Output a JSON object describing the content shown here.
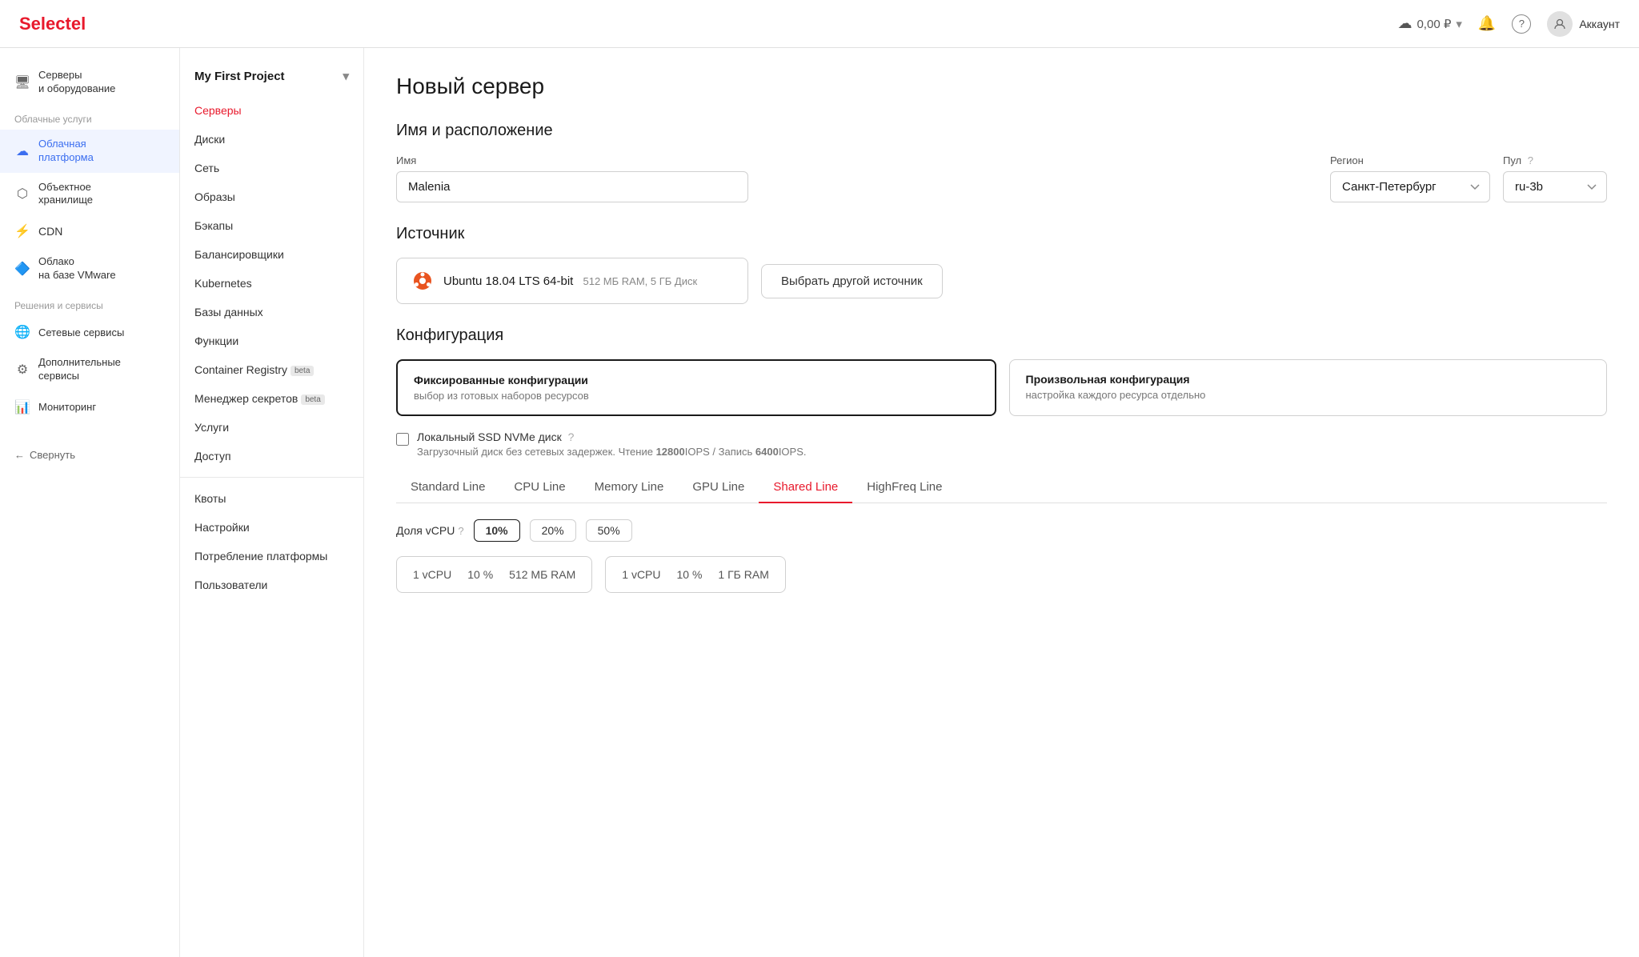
{
  "header": {
    "logo_prefix": "Select",
    "logo_highlight": "el",
    "balance": "0,00 ₽",
    "account_label": "Аккаунт"
  },
  "sidebar_left": {
    "section1": "Облачные услуги",
    "section2": "Решения и сервисы",
    "items": [
      {
        "id": "servers",
        "icon": "🖥",
        "label": "Серверы и оборудование",
        "active": false
      },
      {
        "id": "cloud",
        "icon": "☁",
        "label": "Облачная платформа",
        "active": true
      },
      {
        "id": "object",
        "icon": "📦",
        "label": "Объектное хранилище",
        "active": false
      },
      {
        "id": "cdn",
        "icon": "⚡",
        "label": "CDN",
        "active": false
      },
      {
        "id": "vmware",
        "icon": "🔷",
        "label": "Облако на базе VMware",
        "active": false
      },
      {
        "id": "network",
        "icon": "🌐",
        "label": "Сетевые сервисы",
        "active": false
      },
      {
        "id": "extra",
        "icon": "⚙",
        "label": "Дополнительные сервисы",
        "active": false
      },
      {
        "id": "monitor",
        "icon": "📊",
        "label": "Мониторинг",
        "active": false
      }
    ],
    "collapse_label": "Свернуть"
  },
  "sidebar_mid": {
    "project_name": "My First Project",
    "nav_items": [
      {
        "id": "servers",
        "label": "Серверы",
        "active": true
      },
      {
        "id": "disks",
        "label": "Диски",
        "active": false
      },
      {
        "id": "network",
        "label": "Сеть",
        "active": false
      },
      {
        "id": "images",
        "label": "Образы",
        "active": false
      },
      {
        "id": "backups",
        "label": "Бэкапы",
        "active": false
      },
      {
        "id": "balancers",
        "label": "Балансировщики",
        "active": false
      },
      {
        "id": "kubernetes",
        "label": "Kubernetes",
        "active": false
      },
      {
        "id": "databases",
        "label": "Базы данных",
        "active": false
      },
      {
        "id": "functions",
        "label": "Функции",
        "active": false
      },
      {
        "id": "registry",
        "label": "Container Registry",
        "active": false,
        "badge": "beta"
      },
      {
        "id": "secrets",
        "label": "Менеджер секретов",
        "active": false,
        "badge": "beta"
      },
      {
        "id": "services",
        "label": "Услуги",
        "active": false
      },
      {
        "id": "access",
        "label": "Доступ",
        "active": false
      }
    ],
    "bottom_items": [
      {
        "id": "quotas",
        "label": "Квоты"
      },
      {
        "id": "settings",
        "label": "Настройки"
      },
      {
        "id": "consumption",
        "label": "Потребление платформы"
      },
      {
        "id": "users",
        "label": "Пользователи"
      }
    ]
  },
  "main": {
    "page_title": "Новый сервер",
    "name_section": {
      "title": "Имя и расположение",
      "name_label": "Имя",
      "name_value": "Malenia",
      "region_label": "Регион",
      "region_value": "Санкт-Петербург",
      "pool_label": "Пул",
      "pool_value": "ru-3b"
    },
    "source_section": {
      "title": "Источник",
      "selected_name": "Ubuntu 18.04 LTS 64-bit",
      "selected_meta": "512 МБ RAM, 5 ГБ Диск",
      "change_button": "Выбрать другой источник"
    },
    "config_section": {
      "title": "Конфигурация",
      "option_fixed_title": "Фиксированные конфигурации",
      "option_fixed_desc": "выбор из готовых наборов ресурсов",
      "option_custom_title": "Произвольная конфигурация",
      "option_custom_desc": "настройка каждого ресурса отдельно",
      "nvme_label": "Локальный SSD NVMe диск",
      "nvme_desc": "Загрузочный диск без сетевых задержек. Чтение ",
      "nvme_read": "12800",
      "nvme_read_unit": "IOPS / Запись ",
      "nvme_write": "6400",
      "nvme_write_unit": "IOPS.",
      "tabs": [
        {
          "id": "standard",
          "label": "Standard Line",
          "active": false
        },
        {
          "id": "cpu",
          "label": "CPU Line",
          "active": false
        },
        {
          "id": "memory",
          "label": "Memory Line",
          "active": false
        },
        {
          "id": "gpu",
          "label": "GPU Line",
          "active": false
        },
        {
          "id": "shared",
          "label": "Shared Line",
          "active": true
        },
        {
          "id": "highfreq",
          "label": "HighFreq Line",
          "active": false
        }
      ],
      "vcpu_label": "Доля vCPU",
      "vcpu_options": [
        {
          "value": "10%",
          "selected": true
        },
        {
          "value": "20%",
          "selected": false
        },
        {
          "value": "50%",
          "selected": false
        }
      ],
      "server_cards": [
        {
          "vcpu": "1 vCPU",
          "pct": "10 %",
          "ram": "512 МБ RAM"
        },
        {
          "vcpu": "1 vCPU",
          "pct": "10 %",
          "ram": "1 ГБ RAM"
        }
      ]
    }
  }
}
